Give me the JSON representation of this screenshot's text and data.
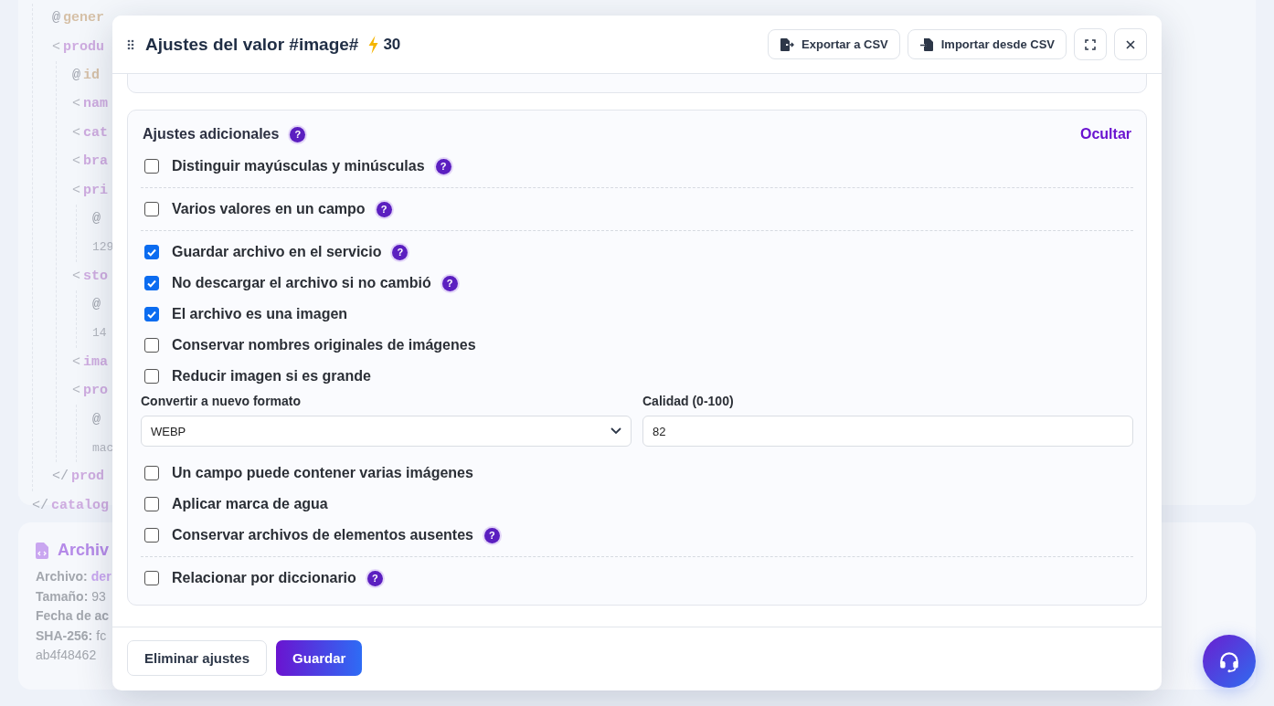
{
  "background": {
    "code": [
      {
        "kind": "attr",
        "mark": "@",
        "text": "gener"
      },
      {
        "kind": "open",
        "mark": "<",
        "text": "produ",
        "children": [
          {
            "kind": "attr",
            "mark": "@",
            "text": "id"
          },
          {
            "kind": "open",
            "mark": "<",
            "text": "nam"
          },
          {
            "kind": "open",
            "mark": "<",
            "text": "cat"
          },
          {
            "kind": "open",
            "mark": "<",
            "text": "bra"
          },
          {
            "kind": "open",
            "mark": "<",
            "text": "pri",
            "children": [
              {
                "kind": "attr",
                "mark": "@"
              },
              {
                "kind": "value",
                "text": "129"
              }
            ]
          },
          {
            "kind": "open",
            "mark": "<",
            "text": "sto",
            "children": [
              {
                "kind": "attr",
                "mark": "@"
              },
              {
                "kind": "value",
                "text": "14"
              }
            ]
          },
          {
            "kind": "open",
            "mark": "<",
            "text": "ima"
          },
          {
            "kind": "open",
            "mark": "<",
            "text": "pro",
            "children": [
              {
                "kind": "attr",
                "mark": "@"
              },
              {
                "kind": "value",
                "text": "mac"
              }
            ]
          }
        ]
      },
      {
        "kind": "close",
        "mark": "</",
        "text": "prod"
      }
    ],
    "code_end": {
      "kind": "close",
      "mark": "</",
      "text": "catalog"
    },
    "file_card": {
      "title": "Archiv",
      "lines": [
        {
          "label": "Archivo:",
          "value": "der",
          "kind": "link"
        },
        {
          "label": "Tamaño:",
          "value": "93",
          "kind": "plain"
        },
        {
          "label": "Fecha de ac"
        },
        {
          "label": "SHA-256:",
          "value": "fc",
          "kind": "plain"
        },
        {
          "value": "ab4f48462",
          "kind": "plain"
        }
      ]
    }
  },
  "modal": {
    "title": "Ajustes del valor #image#",
    "credits": "30",
    "header_buttons": [
      {
        "label": "Exportar a CSV",
        "kind": "export"
      },
      {
        "label": "Importar desde CSV",
        "kind": "import"
      }
    ],
    "section": {
      "title": "Ajustes adicionales",
      "help": "?",
      "toggle": "Ocultar",
      "items": [
        {
          "kind": "checkbox",
          "label": "Distinguir mayúsculas y minúsculas",
          "checked": false,
          "help": "?"
        },
        {
          "kind": "divider"
        },
        {
          "kind": "checkbox",
          "label": "Varios valores en un campo",
          "checked": false,
          "help": "?"
        },
        {
          "kind": "divider"
        },
        {
          "kind": "checkbox",
          "label": "Guardar archivo en el servicio",
          "checked": true,
          "help": "?"
        },
        {
          "kind": "checkbox",
          "label": "No descargar el archivo si no cambió",
          "checked": true,
          "help": "?"
        },
        {
          "kind": "checkbox",
          "label": "El archivo es una imagen",
          "checked": true
        },
        {
          "kind": "checkbox",
          "label": "Conservar nombres originales de imágenes",
          "checked": false
        },
        {
          "kind": "checkbox",
          "label": "Reducir imagen si es grande",
          "checked": false
        },
        {
          "kind": "fields",
          "select": {
            "label": "Convertir a nuevo formato",
            "value": "WEBP"
          },
          "input": {
            "label": "Calidad (0-100)",
            "value": "82"
          }
        },
        {
          "kind": "checkbox",
          "label": "Un campo puede contener varias imágenes",
          "checked": false
        },
        {
          "kind": "checkbox",
          "label": "Aplicar marca de agua",
          "checked": false
        },
        {
          "kind": "checkbox",
          "label": "Conservar archivos de elementos ausentes",
          "checked": false,
          "help": "?"
        },
        {
          "kind": "divider"
        },
        {
          "kind": "checkbox",
          "label": "Relacionar por diccionario",
          "checked": false,
          "help": "?"
        }
      ]
    },
    "footer_buttons": [
      {
        "label": "Eliminar ajustes",
        "kind": "secondary"
      },
      {
        "label": "Guardar",
        "kind": "primary"
      }
    ]
  }
}
